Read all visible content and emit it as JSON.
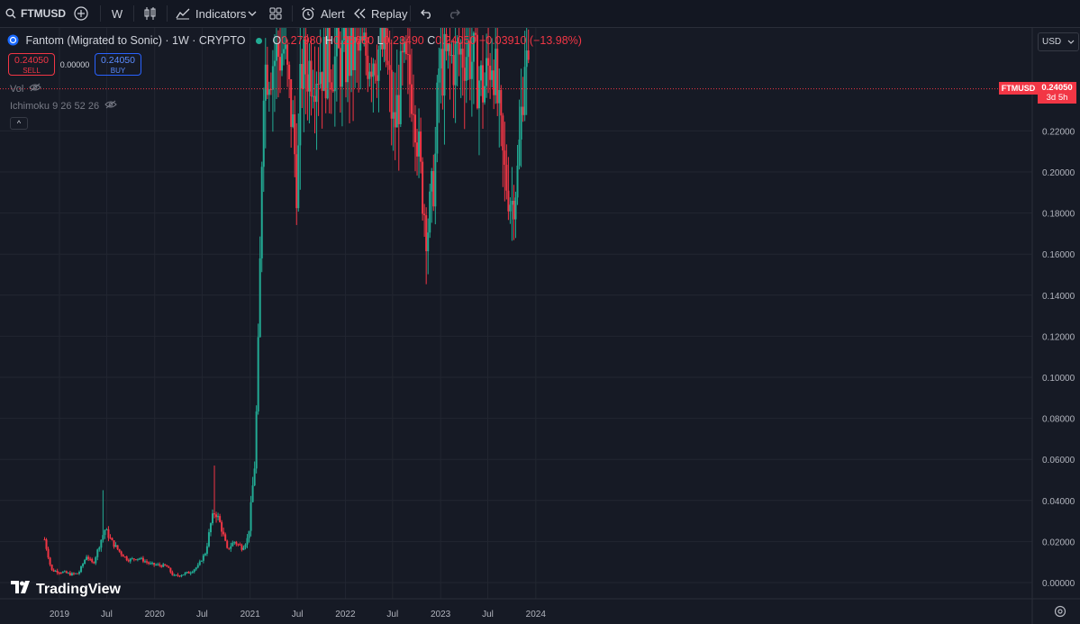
{
  "toolbar": {
    "symbol": "FTMUSD",
    "interval": "W",
    "indicators_label": "Indicators",
    "alert_label": "Alert",
    "replay_label": "Replay"
  },
  "legend": {
    "title": "Fantom (Migrated to Sonic) · 1W · CRYPTO",
    "open_key": "O",
    "open": "0.27980",
    "high_key": "H",
    "high": "0.28680",
    "low_key": "L",
    "low": "0.23490",
    "close_key": "C",
    "close": "0.24050",
    "change": "−0.03910 (−13.98%)"
  },
  "trade": {
    "sell_price": "0.24050",
    "sell_label": "SELL",
    "spread": "0.00000",
    "buy_price": "0.24050",
    "buy_label": "BUY"
  },
  "indicators": {
    "vol": "Vol",
    "ichimoku": "Ichimoku 9 26 52 26"
  },
  "currency": "USD",
  "last_price": {
    "symbol": "FTMUSD",
    "price": "0.24050",
    "countdown": "3d 5h"
  },
  "brand": "TradingView",
  "colors": {
    "up": "#22ab94",
    "down": "#f23645",
    "background": "#161a25",
    "toolbar": "#131722"
  },
  "chart_data": {
    "type": "candlestick",
    "interval": "1W",
    "ylim": [
      0,
      0.24
    ],
    "y_ticks": [
      "0.00000",
      "0.02000",
      "0.04000",
      "0.06000",
      "0.08000",
      "0.10000",
      "0.12000",
      "0.14000",
      "0.16000",
      "0.18000",
      "0.20000",
      "0.22000"
    ],
    "x_ticks": [
      {
        "label": "2019",
        "date": "2019-01-01"
      },
      {
        "label": "Jul",
        "date": "2019-07-01"
      },
      {
        "label": "2020",
        "date": "2020-01-01"
      },
      {
        "label": "Jul",
        "date": "2020-07-01"
      },
      {
        "label": "2021",
        "date": "2021-01-01"
      },
      {
        "label": "Jul",
        "date": "2021-07-01"
      },
      {
        "label": "2022",
        "date": "2022-01-01"
      },
      {
        "label": "Jul",
        "date": "2022-07-01"
      },
      {
        "label": "2023",
        "date": "2023-01-01"
      },
      {
        "label": "Jul",
        "date": "2023-07-01"
      },
      {
        "label": "2024",
        "date": "2024-01-01"
      }
    ],
    "last_close": 0.2405,
    "close_path": [
      [
        "2018-11-05",
        0.021
      ],
      [
        "2018-12-01",
        0.006
      ],
      [
        "2019-01-15",
        0.005
      ],
      [
        "2019-02-15",
        0.004
      ],
      [
        "2019-03-15",
        0.0045
      ],
      [
        "2019-04-15",
        0.013
      ],
      [
        "2019-05-10",
        0.009
      ],
      [
        "2019-06-10",
        0.021
      ],
      [
        "2019-06-25",
        0.026
      ],
      [
        "2019-07-20",
        0.02
      ],
      [
        "2019-08-20",
        0.015
      ],
      [
        "2019-09-20",
        0.011
      ],
      [
        "2019-11-01",
        0.012
      ],
      [
        "2019-12-15",
        0.009
      ],
      [
        "2020-02-15",
        0.008
      ],
      [
        "2020-03-15",
        0.003
      ],
      [
        "2020-04-15",
        0.004
      ],
      [
        "2020-05-15",
        0.005
      ],
      [
        "2020-06-15",
        0.008
      ],
      [
        "2020-07-15",
        0.015
      ],
      [
        "2020-08-05",
        0.03
      ],
      [
        "2020-08-20",
        0.035
      ],
      [
        "2020-09-10",
        0.028
      ],
      [
        "2020-10-05",
        0.016
      ],
      [
        "2020-11-01",
        0.02
      ],
      [
        "2020-12-01",
        0.017
      ],
      [
        "2020-12-25",
        0.022
      ],
      [
        "2021-01-20",
        0.06
      ],
      [
        "2021-02-05",
        0.13
      ],
      [
        "2021-02-20",
        0.25
      ],
      [
        "2021-05-10",
        0.26
      ],
      [
        "2021-06-15",
        0.22
      ],
      [
        "2021-07-01",
        0.19
      ],
      [
        "2021-07-15",
        0.25
      ],
      [
        "2022-06-01",
        0.26
      ],
      [
        "2022-06-20",
        0.24
      ],
      [
        "2022-07-05",
        0.22
      ],
      [
        "2022-08-10",
        0.25
      ],
      [
        "2022-09-20",
        0.24
      ],
      [
        "2022-10-15",
        0.2
      ],
      [
        "2022-11-10",
        0.17
      ],
      [
        "2022-12-10",
        0.2
      ],
      [
        "2022-12-25",
        0.25
      ],
      [
        "2023-04-15",
        0.26
      ],
      [
        "2023-06-15",
        0.24
      ],
      [
        "2023-07-20",
        0.26
      ],
      [
        "2023-08-10",
        0.23
      ],
      [
        "2023-09-01",
        0.2
      ],
      [
        "2023-10-01",
        0.185
      ],
      [
        "2023-10-25",
        0.2
      ],
      [
        "2023-11-20",
        0.26
      ],
      [
        "2023-12-05",
        0.2405
      ]
    ],
    "wick_highs": [
      [
        "2019-06-20",
        0.045
      ],
      [
        "2020-08-20",
        0.057
      ],
      [
        "2021-01-25",
        0.07
      ]
    ]
  }
}
